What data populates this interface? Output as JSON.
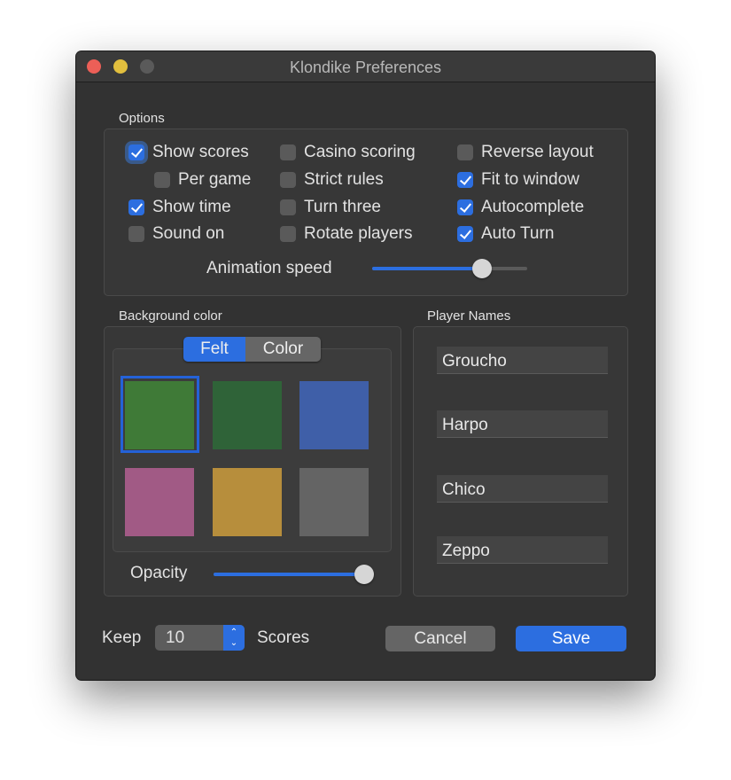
{
  "window": {
    "title": "Klondike Preferences"
  },
  "options": {
    "label": "Options",
    "checkboxes": [
      {
        "label": "Show scores",
        "checked": true
      },
      {
        "label": "Per game",
        "checked": false
      },
      {
        "label": "Show time",
        "checked": true
      },
      {
        "label": "Sound on",
        "checked": false
      },
      {
        "label": "Casino scoring",
        "checked": false
      },
      {
        "label": "Strict rules",
        "checked": false
      },
      {
        "label": "Turn three",
        "checked": false
      },
      {
        "label": "Rotate players",
        "checked": false
      },
      {
        "label": "Reverse layout",
        "checked": false
      },
      {
        "label": "Fit to window",
        "checked": true
      },
      {
        "label": "Autocomplete",
        "checked": true
      },
      {
        "label": "Auto Turn",
        "checked": true
      }
    ],
    "animation_speed": {
      "label": "Animation speed",
      "value": 0.71
    }
  },
  "background": {
    "label": "Background color",
    "segments": [
      "Felt",
      "Color"
    ],
    "selected_segment": "Felt",
    "swatches": [
      "#3f7a37",
      "#2f6338",
      "#3f5fa8",
      "#a15a85",
      "#b78e3c",
      "#646464"
    ],
    "selected_swatch": 0,
    "opacity": {
      "label": "Opacity",
      "value": 1.0
    }
  },
  "players": {
    "label": "Player Names",
    "names": [
      "Groucho",
      "Harpo",
      "Chico",
      "Zeppo"
    ]
  },
  "footer": {
    "keep_label": "Keep",
    "keep_value": "10",
    "scores_label": "Scores",
    "cancel": "Cancel",
    "save": "Save"
  },
  "colors": {
    "accent": "#2c6ee0"
  }
}
